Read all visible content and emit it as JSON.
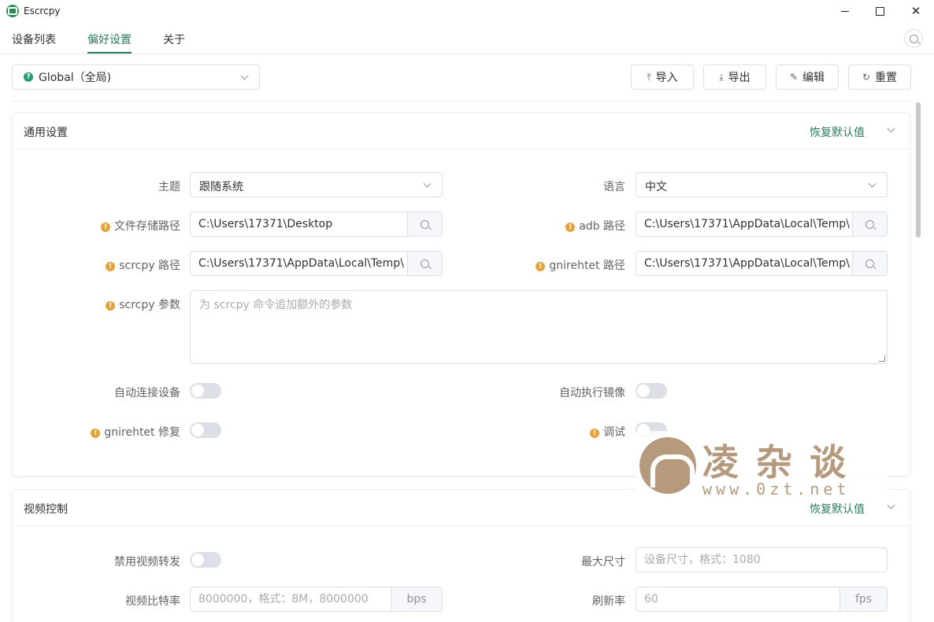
{
  "window": {
    "title": "Escrcpy"
  },
  "tabs": [
    {
      "label": "设备列表"
    },
    {
      "label": "偏好设置"
    },
    {
      "label": "关于"
    }
  ],
  "scope": {
    "selected": "Global（全局)"
  },
  "toolbar": {
    "import_label": "导入",
    "export_label": "导出",
    "edit_label": "编辑",
    "reset_label": "重置"
  },
  "general": {
    "title": "通用设置",
    "reset_label": "恢复默认值",
    "theme": {
      "label": "主题",
      "value": "跟随系统"
    },
    "language": {
      "label": "语言",
      "value": "中文"
    },
    "storage_path": {
      "label": "文件存储路径",
      "value": "C:\\Users\\17371\\Desktop"
    },
    "adb_path": {
      "label": "adb 路径",
      "value": "C:\\Users\\17371\\AppData\\Local\\Temp\\"
    },
    "scrcpy_path": {
      "label": "scrcpy 路径",
      "value": "C:\\Users\\17371\\AppData\\Local\\Temp\\"
    },
    "gnirehtet_path": {
      "label": "gnirehtet 路径",
      "value": "C:\\Users\\17371\\AppData\\Local\\Temp\\"
    },
    "scrcpy_args": {
      "label": "scrcpy 参数",
      "placeholder": "为 scrcpy 命令追加额外的参数"
    },
    "auto_connect": {
      "label": "自动连接设备",
      "on": false
    },
    "auto_mirror": {
      "label": "自动执行镜像",
      "on": false
    },
    "gnirehtet_fix": {
      "label": "gnirehtet 修复",
      "on": false
    },
    "debug": {
      "label": "调试",
      "on": false
    }
  },
  "video": {
    "title": "视频控制",
    "reset_label": "恢复默认值",
    "disable_forward": {
      "label": "禁用视频转发",
      "on": false
    },
    "max_size": {
      "label": "最大尺寸",
      "placeholder": "设备尺寸，格式：1080"
    },
    "bitrate": {
      "label": "视频比特率",
      "placeholder": "8000000，格式：8M，8000000",
      "unit": "bps"
    },
    "refresh_rate": {
      "label": "刷新率",
      "placeholder": "60",
      "unit": "fps"
    }
  },
  "watermark": {
    "text": "凌杂谈",
    "url": "www.0zt.net"
  },
  "colors": {
    "accent": "#2a7d5b",
    "warning": "#e6a23c",
    "watermark": "#b59a7e"
  }
}
